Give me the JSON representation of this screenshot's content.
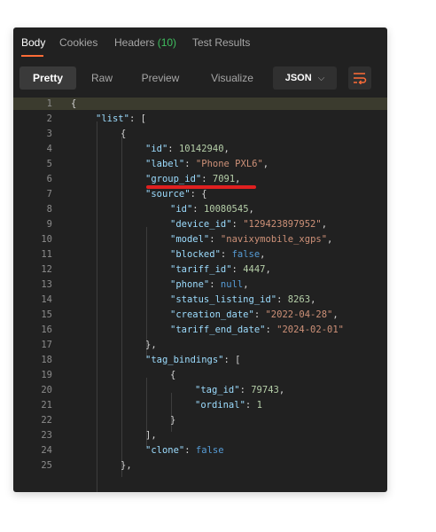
{
  "tabs": [
    {
      "label": "Body"
    },
    {
      "label": "Cookies"
    },
    {
      "label": "Headers",
      "count": "(10)"
    },
    {
      "label": "Test Results"
    }
  ],
  "toolbar": {
    "pretty": "Pretty",
    "raw": "Raw",
    "preview": "Preview",
    "visualize": "Visualize",
    "format": "JSON",
    "format_caret": "⌵"
  },
  "colors": {
    "accent": "#ff6c37",
    "key": "#9cdcfe",
    "string": "#ce9178",
    "number": "#b5cea8",
    "literal": "#569cd6",
    "annotation": "#e02020"
  },
  "code": {
    "lines": [
      {
        "n": "1",
        "text": "{"
      },
      {
        "n": "2",
        "text": "\"list\": ["
      },
      {
        "n": "3",
        "text": "{"
      },
      {
        "n": "4",
        "text": "\"id\": 10142940,"
      },
      {
        "n": "5",
        "text": "\"label\": \"Phone PXL6\","
      },
      {
        "n": "6",
        "text": "\"group_id\": 7091,"
      },
      {
        "n": "7",
        "text": "\"source\": {"
      },
      {
        "n": "8",
        "text": "\"id\": 10080545,"
      },
      {
        "n": "9",
        "text": "\"device_id\": \"129423897952\","
      },
      {
        "n": "10",
        "text": "\"model\": \"navixymobile_xgps\","
      },
      {
        "n": "11",
        "text": "\"blocked\": false,"
      },
      {
        "n": "12",
        "text": "\"tariff_id\": 4447,"
      },
      {
        "n": "13",
        "text": "\"phone\": null,"
      },
      {
        "n": "14",
        "text": "\"status_listing_id\": 8263,"
      },
      {
        "n": "15",
        "text": "\"creation_date\": \"2022-04-28\","
      },
      {
        "n": "16",
        "text": "\"tariff_end_date\": \"2024-02-01\""
      },
      {
        "n": "17",
        "text": "},"
      },
      {
        "n": "18",
        "text": "\"tag_bindings\": ["
      },
      {
        "n": "19",
        "text": "{"
      },
      {
        "n": "20",
        "text": "\"tag_id\": 79743,"
      },
      {
        "n": "21",
        "text": "\"ordinal\": 1"
      },
      {
        "n": "22",
        "text": "}"
      },
      {
        "n": "23",
        "text": "],"
      },
      {
        "n": "24",
        "text": "\"clone\": false"
      },
      {
        "n": "25",
        "text": "},"
      }
    ]
  }
}
